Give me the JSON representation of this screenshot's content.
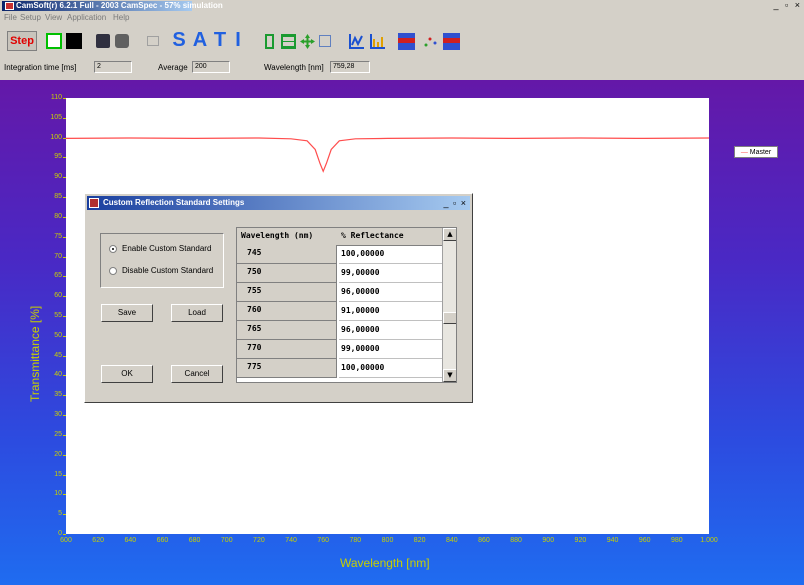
{
  "window": {
    "title": "CamSoft(r) 6.2.1 Full - 2003 CamSpec - 57% simulation",
    "controls": "_ ▫ ×"
  },
  "menu": [
    "File",
    "Setup",
    "View",
    "Application",
    "Help"
  ],
  "toolbar": {
    "step_label": "Step",
    "letters": [
      "S",
      "A",
      "T",
      "I"
    ]
  },
  "params": {
    "integration_label": "Integration time [ms]",
    "integration_value": "2",
    "average_label": "Average",
    "average_value": "200",
    "wavelength_label": "Wavelength [nm]",
    "wavelength_value": "759,28"
  },
  "legend": "Master",
  "chart_data": {
    "type": "line",
    "xlabel": "Wavelength [nm]",
    "ylabel": "Transmittance [%]",
    "xlim": [
      600,
      1000
    ],
    "ylim": [
      0,
      110
    ],
    "x_ticks": [
      "600",
      "620",
      "640",
      "660",
      "680",
      "700",
      "720",
      "740",
      "760",
      "780",
      "800",
      "820",
      "840",
      "860",
      "880",
      "900",
      "920",
      "940",
      "960",
      "980",
      "1.000"
    ],
    "y_ticks": [
      "0",
      "5",
      "10",
      "15",
      "20",
      "25",
      "30",
      "35",
      "40",
      "45",
      "50",
      "55",
      "60",
      "65",
      "70",
      "75",
      "80",
      "85",
      "90",
      "95",
      "100",
      "105",
      "110"
    ],
    "series": [
      {
        "name": "Master",
        "color": "#ff4d4d",
        "x": [
          600,
          640,
          680,
          720,
          740,
          750,
          755,
          758,
          760,
          762,
          765,
          770,
          780,
          800,
          840,
          880,
          920,
          960,
          1000
        ],
        "y": [
          99.8,
          99.9,
          99.8,
          99.9,
          99.7,
          99.2,
          97,
          93.5,
          91.5,
          93.5,
          97,
          99.2,
          99.7,
          99.8,
          99.9,
          99.8,
          99.9,
          99.8,
          99.9
        ]
      }
    ]
  },
  "dialog": {
    "title": "Custom Reflection Standard Settings",
    "controls": "_ ▫ ×",
    "radio_enable": "Enable Custom Standard",
    "radio_disable": "Disable Custom Standard",
    "save_label": "Save",
    "load_label": "Load",
    "ok_label": "OK",
    "cancel_label": "Cancel",
    "col_wavelength": "Wavelength (nm)",
    "col_reflectance": "% Reflectance",
    "rows": [
      {
        "wl": "745",
        "r": "100,00000"
      },
      {
        "wl": "750",
        "r": "99,00000"
      },
      {
        "wl": "755",
        "r": "96,00000"
      },
      {
        "wl": "760",
        "r": "91,00000"
      },
      {
        "wl": "765",
        "r": "96,00000"
      },
      {
        "wl": "770",
        "r": "99,00000"
      },
      {
        "wl": "775",
        "r": "100,00000"
      }
    ]
  }
}
